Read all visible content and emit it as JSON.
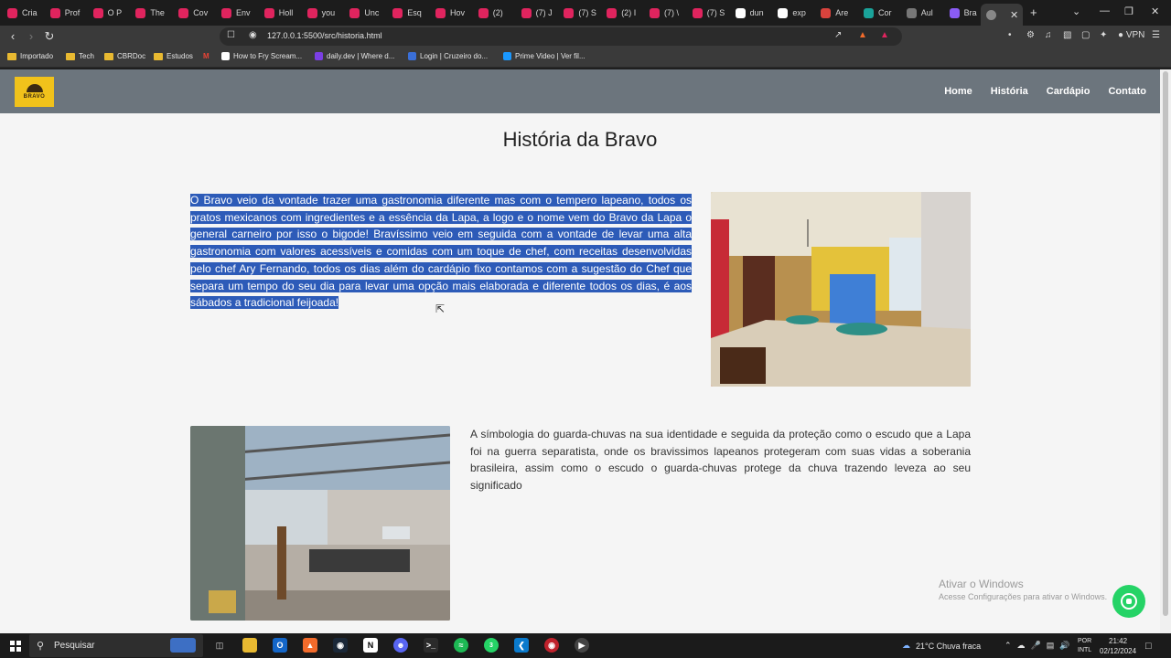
{
  "browser": {
    "tabs": [
      {
        "label": "Cria",
        "color": "#e0245e"
      },
      {
        "label": "Prof",
        "color": "#e0245e"
      },
      {
        "label": "O P",
        "color": "#e0245e"
      },
      {
        "label": "The",
        "color": "#e0245e"
      },
      {
        "label": "Cov",
        "color": "#e0245e"
      },
      {
        "label": "Env",
        "color": "#e0245e"
      },
      {
        "label": "Holl",
        "color": "#e0245e"
      },
      {
        "label": "you",
        "color": "#e0245e"
      },
      {
        "label": "Unc",
        "color": "#e0245e"
      },
      {
        "label": "Esq",
        "color": "#e0245e"
      },
      {
        "label": "Hov",
        "color": "#e0245e"
      },
      {
        "label": "(2)",
        "color": "#e0245e"
      },
      {
        "label": "(7) J",
        "color": "#e0245e"
      },
      {
        "label": "(7) S",
        "color": "#e0245e"
      },
      {
        "label": "(2) I",
        "color": "#e0245e"
      },
      {
        "label": "(7) \\",
        "color": "#e0245e"
      },
      {
        "label": "(7) S",
        "color": "#e0245e"
      },
      {
        "label": "dun",
        "color": "#ffffff"
      },
      {
        "label": "exp",
        "color": "#ffffff"
      },
      {
        "label": "Are",
        "color": "#d9433d"
      },
      {
        "label": "Cor",
        "color": "#1aa39a"
      },
      {
        "label": "Aul",
        "color": "#777777"
      },
      {
        "label": "Bra",
        "color": "#8b5cf6"
      }
    ],
    "active_tab_close": "✕",
    "new_tab": "+",
    "url": "127.0.0.1:5500/src/historia.html",
    "vpn_label": "VPN",
    "bookmarks": [
      {
        "label": "Importado",
        "kind": "folder"
      },
      {
        "label": "Tech",
        "kind": "folder"
      },
      {
        "label": "CBRDoc",
        "kind": "folder"
      },
      {
        "label": "Estudos",
        "kind": "folder"
      },
      {
        "label": "How to Fry Scream...",
        "kind": "site",
        "color": "#ffffff"
      },
      {
        "label": "daily.dev | Where d...",
        "kind": "site",
        "color": "#7b3fe4"
      },
      {
        "label": "Login | Cruzeiro do...",
        "kind": "site",
        "color": "#3a6fd8"
      },
      {
        "label": "Prime Video | Ver fil...",
        "kind": "site",
        "color": "#1a98ff"
      }
    ]
  },
  "site": {
    "logo_text": "BRAVO",
    "nav": [
      {
        "label": "Home"
      },
      {
        "label": "História"
      },
      {
        "label": "Cardápio"
      },
      {
        "label": "Contato"
      }
    ],
    "title": "História da Bravo",
    "paragraph1": "O Bravo veio da vontade trazer uma gastronomia diferente mas com o tempero lapeano, todos os pratos mexicanos com ingredientes e a essência da Lapa, a logo e o nome vem do Bravo da Lapa o general carneiro por isso o bigode! Bravíssimo veio em seguida com a vontade de levar uma alta gastronomia com valores acessíveis e comidas com um toque de chef, com receitas desenvolvidas pelo chef Ary Fernando, todos os dias além do cardápio fixo contamos com a sugestão do Chef que separa um tempo do seu dia para levar uma opção mais elaborada e diferente todos os dias, é aos sábados a tradicional feijoada!",
    "paragraph2": "A símbologia do guarda-chuvas na sua identidade e seguida da proteção como o escudo que a Lapa foi na guerra separatista, onde os bravissimos lapeanos protegeram com suas vidas a soberania brasileira, assim como o escudo o guarda-chuvas protege da chuva trazendo leveza ao seu significado"
  },
  "windows_activation": {
    "title": "Ativar o Windows",
    "subtitle": "Acesse Configurações para ativar o Windows."
  },
  "taskbar": {
    "search_placeholder": "Pesquisar",
    "weather": "21°C  Chuva fraca",
    "lang_top": "POR",
    "lang_bottom": "INTL",
    "time": "21:42",
    "date": "02/12/2024",
    "whatsapp_badge": "3"
  }
}
